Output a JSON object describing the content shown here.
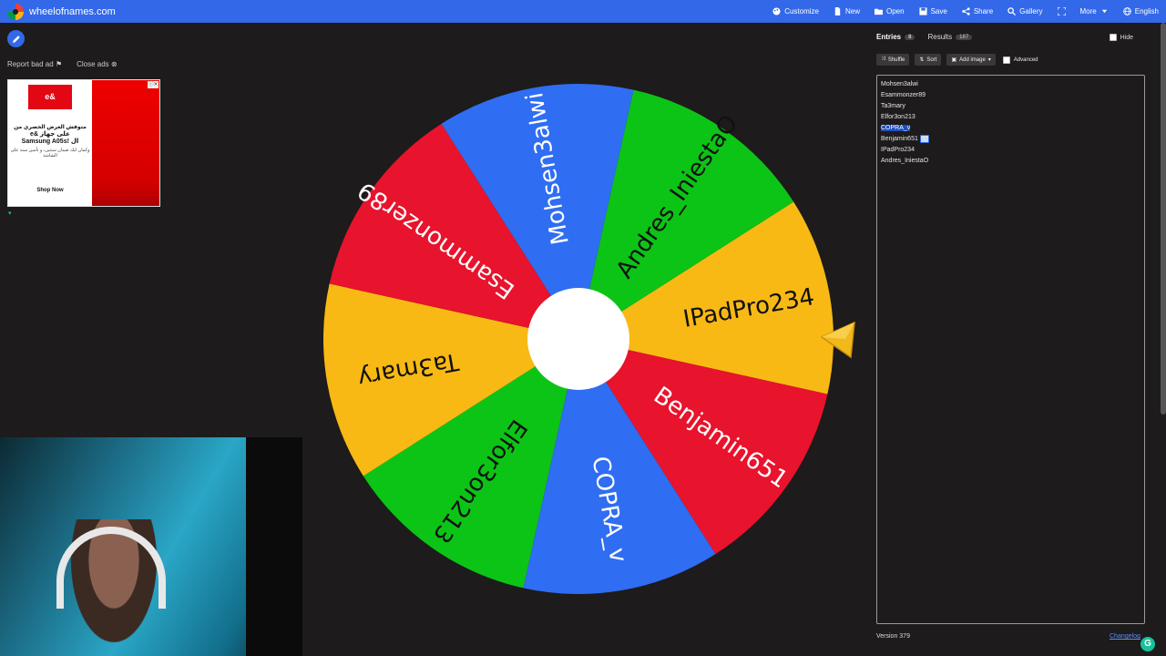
{
  "topbar": {
    "site_name": "wheelofnames.com",
    "nav": [
      {
        "label": "Customize",
        "icon": "palette-icon"
      },
      {
        "label": "New",
        "icon": "file-icon"
      },
      {
        "label": "Open",
        "icon": "folder-icon"
      },
      {
        "label": "Save",
        "icon": "save-icon"
      },
      {
        "label": "Share",
        "icon": "share-icon"
      },
      {
        "label": "Gallery",
        "icon": "search-icon"
      },
      {
        "label": "",
        "icon": "fullscreen-icon"
      },
      {
        "label": "More",
        "icon": "chevron-down-icon"
      },
      {
        "label": "English",
        "icon": "globe-icon"
      }
    ]
  },
  "ads": {
    "report": "Report bad ad",
    "close": "Close ads",
    "logo_text": "e&",
    "line1": "متوفش العرض الحصري من",
    "line2": "e& على جهاز",
    "line3": "Samsung A05s! ال",
    "line4": "وكمان ليك ضمان سنتين، و تأمين سنة على الشاشة",
    "shop": "Shop Now"
  },
  "wheel": {
    "segments": [
      {
        "name": "IPadPro234",
        "color": "#f8b914"
      },
      {
        "name": "Benjamin651",
        "color": "#e8132c"
      },
      {
        "name": "COPRA_v",
        "color": "#2f6df2"
      },
      {
        "name": "Elfor3on213",
        "color": "#0cc416"
      },
      {
        "name": "Ta3mary",
        "color": "#f8b914"
      },
      {
        "name": "Esammonzer89",
        "color": "#e8132c"
      },
      {
        "name": "Mohsen3alwi",
        "color": "#2f6df2"
      },
      {
        "name": "Andres_IniestaO",
        "color": "#0cc416"
      }
    ]
  },
  "sidebar": {
    "tab_entries": "Entries",
    "entries_count": "8",
    "tab_results": "Results",
    "results_count": "187",
    "hide": "Hide",
    "shuffle": "Shuffle",
    "sort": "Sort",
    "add_image": "Add image",
    "advanced": "Advanced",
    "entries": [
      "Mohsen3alwi",
      "Esammonzer89",
      "Ta3mary",
      "Elfor3on213",
      "COPRA_v",
      "Benjamin651",
      "IPadPro234",
      "Andres_IniestaO"
    ],
    "selected_entry": "COPRA_v",
    "version": "Version 379",
    "changelog": "Changelog"
  }
}
